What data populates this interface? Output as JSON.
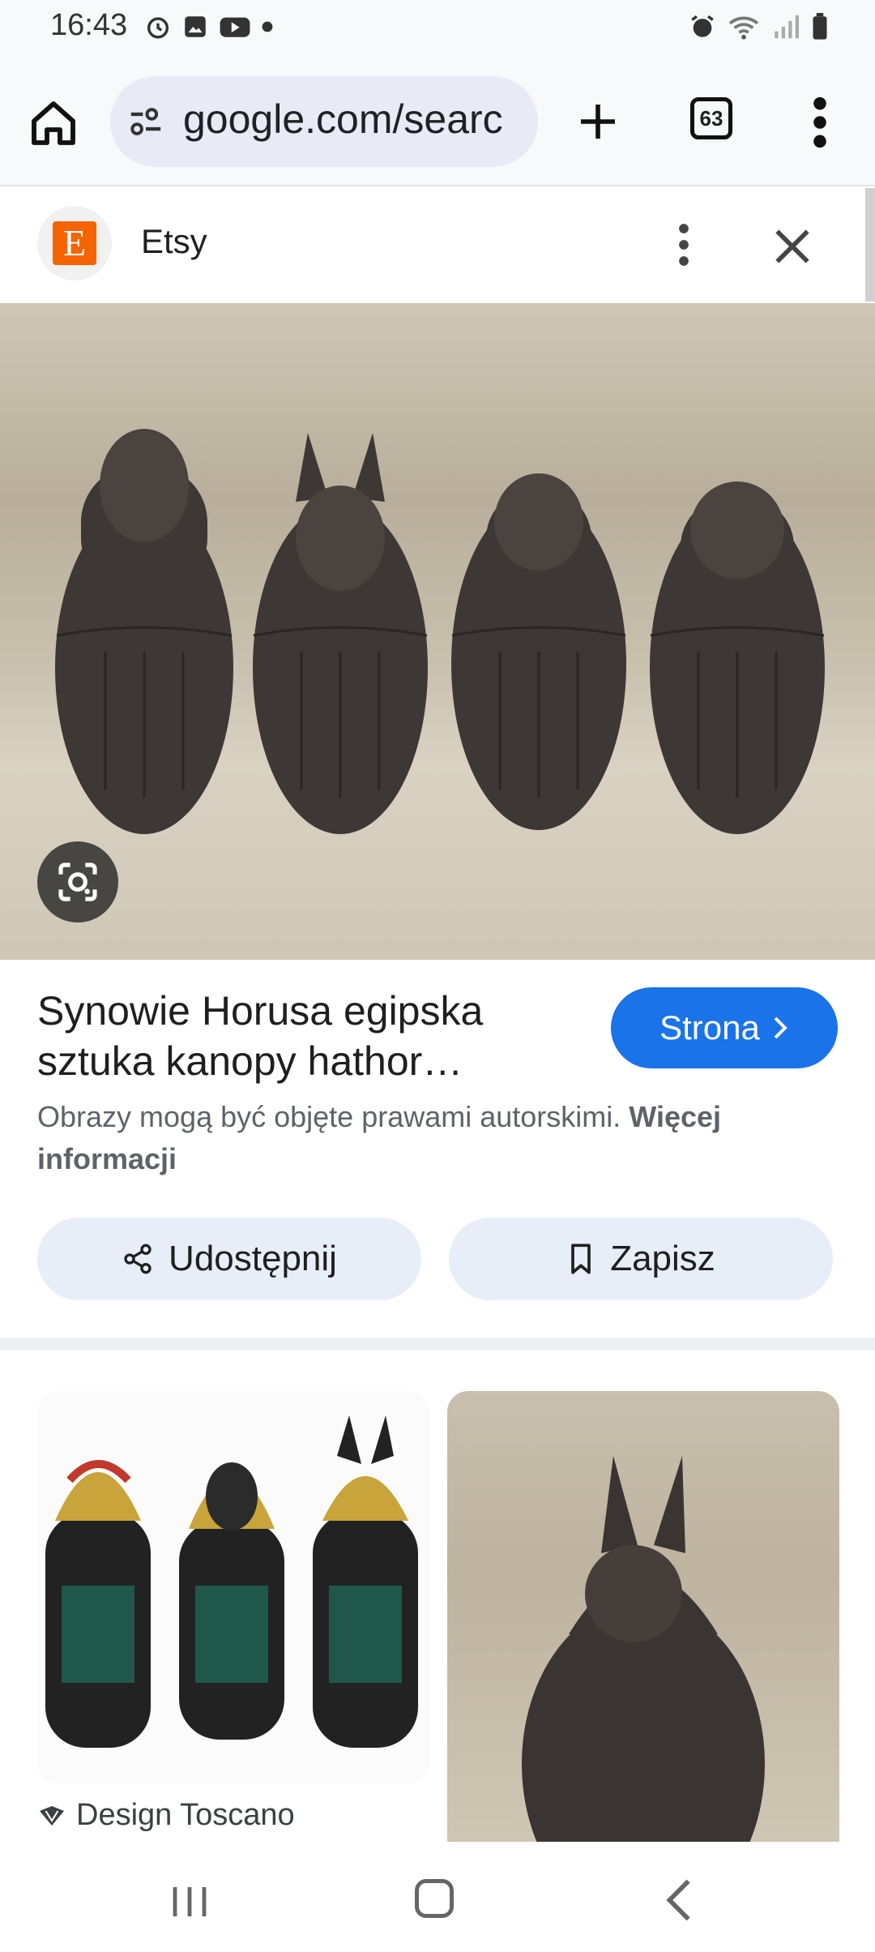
{
  "status_bar": {
    "time": "16:43"
  },
  "browser": {
    "url": "google.com/searc",
    "tab_count": "63"
  },
  "source": {
    "name": "Etsy",
    "logo_letter": "E",
    "logo_color": "#f56400"
  },
  "result": {
    "title": "Synowie Horusa egipska sztuka kanopy hathor…",
    "visit_label": "Strona",
    "copyright_text": "Obrazy mogą być objęte prawami autorskimi. ",
    "more_info_label": "Więcej informacji"
  },
  "actions": {
    "share_label": "Udostępnij",
    "save_label": "Zapisz"
  },
  "related": [
    {
      "source_name": "Design Toscano"
    }
  ],
  "colors": {
    "accent": "#1a73e8",
    "action_button_bg": "#e7eef8"
  }
}
